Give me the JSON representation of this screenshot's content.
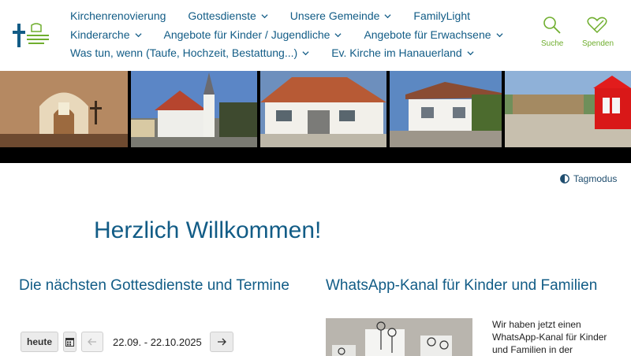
{
  "nav": {
    "row1": [
      {
        "label": "Kirchenrenovierung",
        "dropdown": false
      },
      {
        "label": "Gottesdienste",
        "dropdown": true
      },
      {
        "label": "Unsere Gemeinde",
        "dropdown": true
      },
      {
        "label": "FamilyLight",
        "dropdown": false
      }
    ],
    "row2": [
      {
        "label": "Kinderarche",
        "dropdown": true
      },
      {
        "label": "Angebote für Kinder / Jugendliche",
        "dropdown": true
      },
      {
        "label": "Angebote für Erwachsene",
        "dropdown": true
      }
    ],
    "row3": [
      {
        "label": "Was tun, wenn (Taufe, Hochzeit, Bestattung...)",
        "dropdown": true
      },
      {
        "label": "Ev. Kirche im Hanauerland",
        "dropdown": true
      }
    ]
  },
  "tools": {
    "search_label": "Suche",
    "donate_label": "Spenden"
  },
  "daymode_label": "Tagmodus",
  "welcome_title": "Herzlich Willkommen!",
  "events": {
    "heading": "Die nächsten Gottesdienste und Termine",
    "today_label": "heute",
    "date_range": "22.09. - 22.10.2025"
  },
  "whatsapp": {
    "heading": "WhatsApp-Kanal für Kinder und Familien",
    "text_lines": [
      "Wir haben jetzt einen",
      "WhatsApp-Kanal für Kinder",
      "und Familien in der"
    ]
  },
  "colors": {
    "nav_blue": "#125c86",
    "accent_green": "#6fae2e",
    "text_dark": "#222222"
  },
  "icons": [
    "logo-cross-icon",
    "chevron-down-icon",
    "search-icon",
    "heart-pen-icon",
    "contrast-icon",
    "calendar-icon",
    "arrow-left-icon",
    "arrow-right-icon"
  ]
}
